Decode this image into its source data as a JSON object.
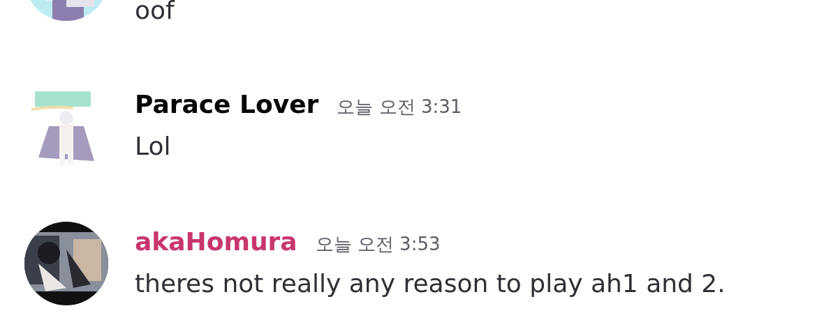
{
  "messages": [
    {
      "kind": "continuation",
      "text": "oof"
    },
    {
      "kind": "full",
      "author": "Parace Lover",
      "color": "#060607",
      "time": "오늘 오전 3:31",
      "text": "Lol",
      "avatar": {
        "kind": "cutout"
      }
    },
    {
      "kind": "full",
      "author": "akaHomura",
      "color": "#c8366e",
      "time": "오늘 오전 3:53",
      "text": "theres not really any reason to play ah1 and 2.",
      "avatar": {
        "kind": "round"
      }
    }
  ]
}
